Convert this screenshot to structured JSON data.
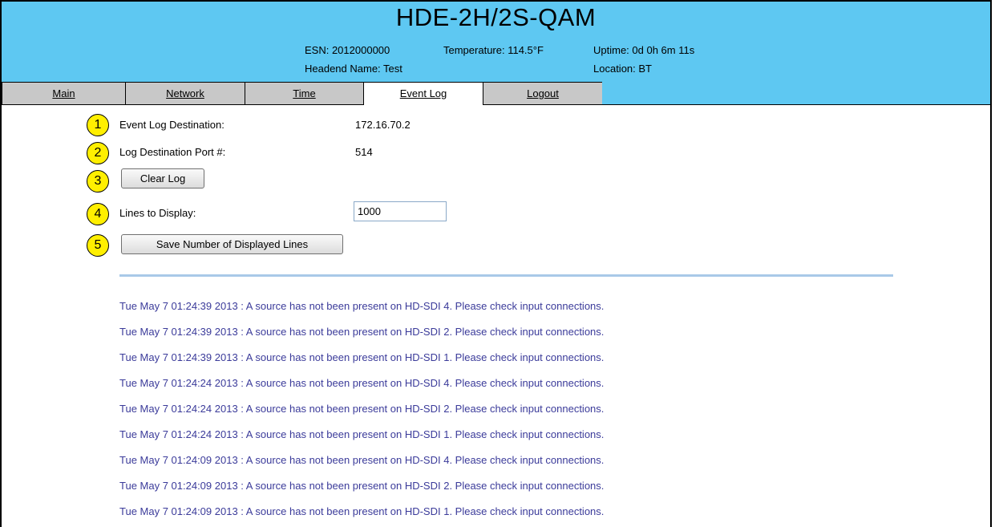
{
  "header": {
    "title": "HDE-2H/2S-QAM",
    "esn": "ESN: 2012000000",
    "headend_name": "Headend Name: Test",
    "temperature": "Temperature: 114.5°F",
    "uptime": "Uptime: 0d 0h 6m 11s",
    "location": "Location: BT",
    "bg_color": "#5ec8f2"
  },
  "nav": {
    "tabs": [
      {
        "label": "Main"
      },
      {
        "label": "Network"
      },
      {
        "label": "Time"
      },
      {
        "label": "Event Log",
        "active": true
      },
      {
        "label": "Logout"
      }
    ]
  },
  "form": {
    "destination_label": "Event Log Destination:",
    "destination_value": "172.16.70.2",
    "port_label": "Log Destination Port #:",
    "port_value": "514",
    "clear_button": "Clear Log",
    "lines_label": "Lines to Display:",
    "lines_value": "1000",
    "save_button": "Save Number of Displayed Lines"
  },
  "callouts": [
    "1",
    "2",
    "3",
    "4",
    "5"
  ],
  "log": {
    "text_color": "#3b3b9a",
    "lines": [
      "Tue May 7 01:24:39 2013 : A source has not been present on HD-SDI 4. Please check input connections.",
      "Tue May 7 01:24:39 2013 : A source has not been present on HD-SDI 2. Please check input connections.",
      "Tue May 7 01:24:39 2013 : A source has not been present on HD-SDI 1. Please check input connections.",
      "Tue May 7 01:24:24 2013 : A source has not been present on HD-SDI 4. Please check input connections.",
      "Tue May 7 01:24:24 2013 : A source has not been present on HD-SDI 2. Please check input connections.",
      "Tue May 7 01:24:24 2013 : A source has not been present on HD-SDI 1. Please check input connections.",
      "Tue May 7 01:24:09 2013 : A source has not been present on HD-SDI 4. Please check input connections.",
      "Tue May 7 01:24:09 2013 : A source has not been present on HD-SDI 2. Please check input connections.",
      "Tue May 7 01:24:09 2013 : A source has not been present on HD-SDI 1. Please check input connections."
    ]
  }
}
